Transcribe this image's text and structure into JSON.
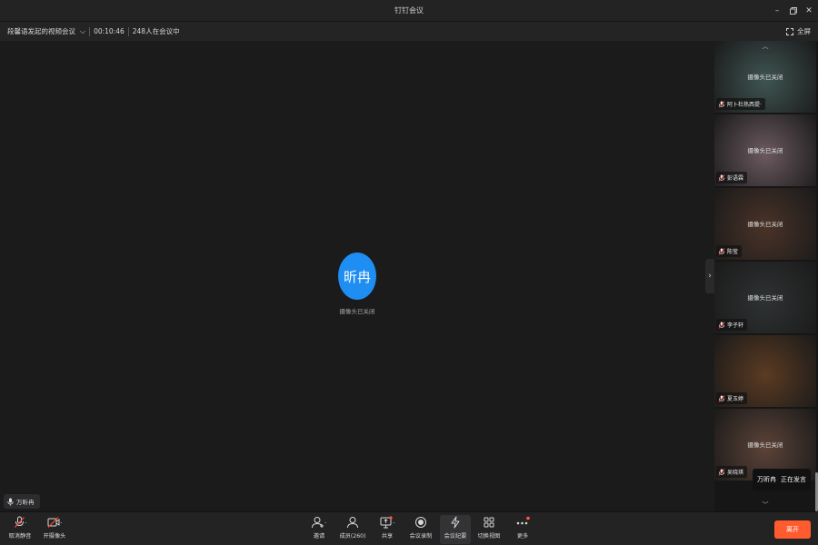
{
  "window": {
    "title": "钉钉会议"
  },
  "infobar": {
    "meeting_title": "段馨语发起的视频会议",
    "elapsed": "00:10:46",
    "attendees": "248人在会议中",
    "fullscreen_label": "全屏"
  },
  "main": {
    "avatar_text": "昕冉",
    "camera_off": "摄像头已关闭",
    "speaker_name": "万昕冉"
  },
  "sidebar": {
    "participants": [
      {
        "name": "阿卜杜热西提·",
        "camera_off": "摄像头已关闭",
        "bg": "#3f5552"
      },
      {
        "name": "彭语霖",
        "camera_off": "摄像头已关闭",
        "bg": "#6b5a5f"
      },
      {
        "name": "陈莹",
        "camera_off": "摄像头已关闭",
        "bg": "#4a3328"
      },
      {
        "name": "李子轩",
        "camera_off": "摄像头已关闭",
        "bg": "#2f3233"
      },
      {
        "name": "夏玉婷",
        "camera_off": "",
        "bg": "#5b3b22"
      },
      {
        "name": "吴晓琪",
        "camera_off": "摄像头已关闭",
        "bg": "#5c4338"
      }
    ],
    "speaking_name": "万昕冉",
    "speaking_label": "正在发言"
  },
  "toolbar": {
    "unmute": "取消静音",
    "camera_on": "开摄像头",
    "invite": "邀请",
    "members": "成员(260)",
    "share": "共享",
    "record": "会议录制",
    "minutes": "会议纪要",
    "switch_view": "切换视图",
    "more": "更多",
    "leave": "离开"
  },
  "colors": {
    "avatar": "#1e8ef2",
    "leave": "#ff5b2e",
    "notification_dot": "#ff5a3c"
  }
}
